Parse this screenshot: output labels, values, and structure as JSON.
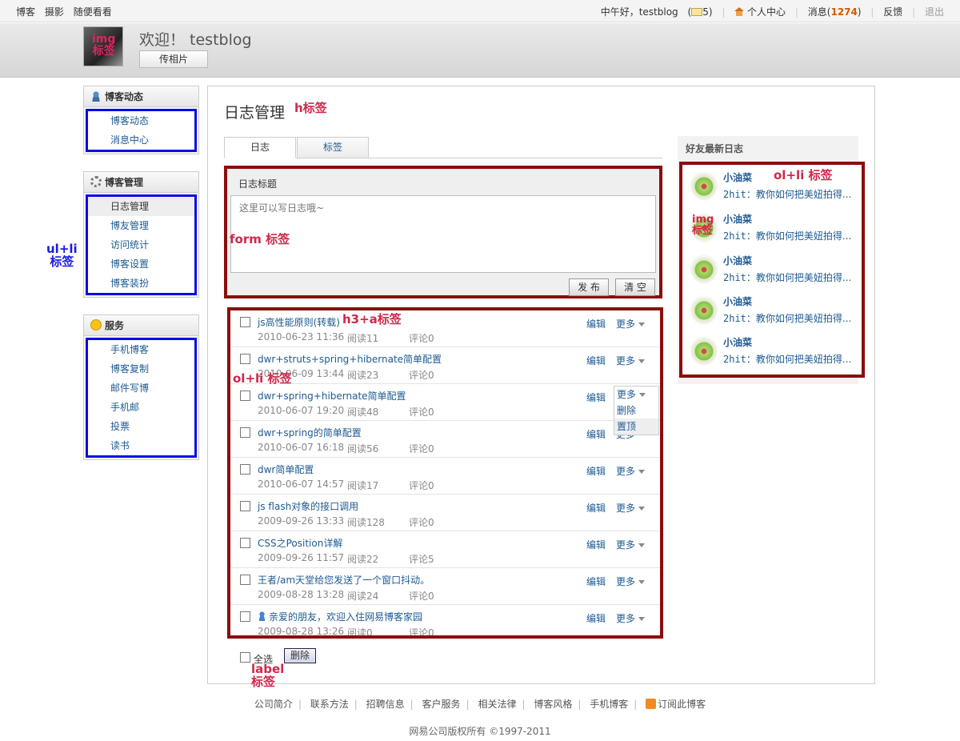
{
  "topbar": {
    "left_links": [
      "博客",
      "摄影",
      "随便看看"
    ],
    "greeting": "中午好，testblog",
    "mail_count": "5",
    "personal_center": "个人中心",
    "messages_label": "消息",
    "messages_count": "1274",
    "feedback": "反馈",
    "logout": "退出"
  },
  "header": {
    "welcome": "欢迎！ testblog",
    "upload_button": "传相片",
    "avatar_annotation": "img\n标签"
  },
  "sidebar": {
    "sections": [
      {
        "title": "博客动态",
        "icon": "user-icon",
        "items": [
          "博客动态",
          "消息中心"
        ]
      },
      {
        "title": "博客管理",
        "icon": "gear-icon",
        "items": [
          "日志管理",
          "博友管理",
          "访问统计",
          "博客设置",
          "博客装扮"
        ]
      },
      {
        "title": "服务",
        "icon": "smile-icon",
        "items": [
          "手机博客",
          "博客复制",
          "邮件写博",
          "手机邮",
          "投票",
          "读书"
        ]
      }
    ],
    "annotation": "ul+li\n标签"
  },
  "main": {
    "title": "日志管理",
    "title_annotation": "h标签",
    "tabs": [
      "日志",
      "标签"
    ],
    "form": {
      "label": "日志标题",
      "placeholder": "这里可以写日志哦~",
      "annotation": "form 标签",
      "publish_button": "发 布",
      "clear_button": "清 空"
    },
    "list_annotation": "ol+li 标签",
    "h3_annotation": "h3+a标签",
    "edit_label": "编辑",
    "more_label": "更多",
    "dropdown_items": [
      "删除",
      "置顶"
    ],
    "posts": [
      {
        "title": "js高性能原则(转载)",
        "date": "2010-06-23 11:36",
        "reads": "阅读11",
        "comments": "评论0"
      },
      {
        "title": "dwr+struts+spring+hibernate简单配置",
        "date": "2010-06-09 13:44",
        "reads": "阅读23",
        "comments": "评论0"
      },
      {
        "title": "dwr+spring+hibernate简单配置",
        "date": "2010-06-07 19:20",
        "reads": "阅读48",
        "comments": "评论0"
      },
      {
        "title": "dwr+spring的简单配置",
        "date": "2010-06-07 16:18",
        "reads": "阅读56",
        "comments": "评论0"
      },
      {
        "title": "dwr简单配置",
        "date": "2010-06-07 14:57",
        "reads": "阅读17",
        "comments": "评论0"
      },
      {
        "title": "js flash对象的接口调用",
        "date": "2009-09-26 13:33",
        "reads": "阅读128",
        "comments": "评论0"
      },
      {
        "title": "CSS之Position详解",
        "date": "2009-09-26 11:57",
        "reads": "阅读22",
        "comments": "评论5"
      },
      {
        "title": "王者/am天堂给您发送了一个窗口抖动。",
        "date": "2009-08-28 13:28",
        "reads": "阅读24",
        "comments": "评论0"
      },
      {
        "title": "亲爱的朋友，欢迎入住网易博客家园",
        "date": "2009-08-28 13:26",
        "reads": "阅读0",
        "comments": "评论0"
      }
    ],
    "select_all": "全选",
    "delete_button": "删除",
    "label_annotation": "label\n标签"
  },
  "friends": {
    "title": "好友最新日志",
    "annotation": "ol+li 标签",
    "img_annotation": "img\n标签",
    "items": [
      {
        "name": "小油菜",
        "author": "2hit",
        "post": "：教你如何把美妞拍得..."
      },
      {
        "name": "小油菜",
        "author": "2hit",
        "post": "：教你如何把美妞拍得..."
      },
      {
        "name": "小油菜",
        "author": "2hit",
        "post": "：教你如何把美妞拍得..."
      },
      {
        "name": "小油菜",
        "author": "2hit",
        "post": "：教你如何把美妞拍得..."
      },
      {
        "name": "小油菜",
        "author": "2hit",
        "post": "：教你如何把美妞拍得..."
      }
    ]
  },
  "footer": {
    "links": [
      "公司简介",
      "联系方法",
      "招聘信息",
      "客户服务",
      "相关法律",
      "博客风格",
      "手机博客",
      "订阅此博客"
    ],
    "copyright": "网易公司版权所有 ©1997-2011"
  },
  "colors": {
    "annotation_red": "#d0284a",
    "annotation_blue": "#1a1ae6",
    "box_red": "#8b0d0d",
    "box_blue": "#0a0ae6",
    "link": "#1c5a94",
    "message_count": "#d35a00"
  }
}
